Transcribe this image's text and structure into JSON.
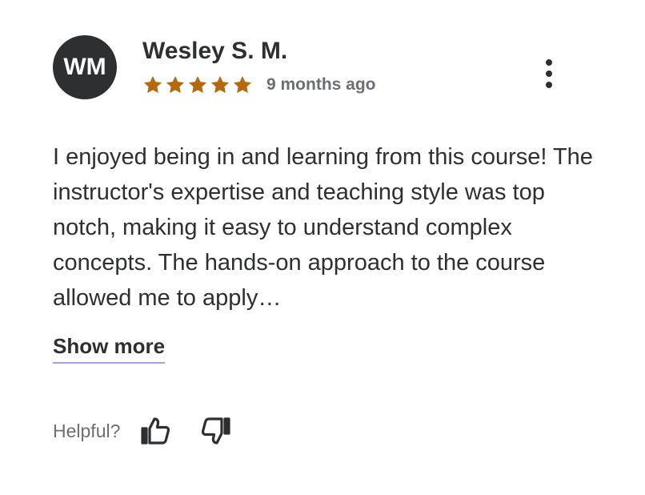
{
  "review": {
    "avatar_initials": "WM",
    "reviewer_name": "Wesley S. M.",
    "rating": 5,
    "max_rating": 5,
    "star_color": "#b4690e",
    "time_ago": "9 months ago",
    "text": "I enjoyed being in and learning from this course! The instructor's expertise and teaching style was top notch, making it easy to understand complex concepts. The hands-on approach to the course allowed me to apply…",
    "show_more_label": "Show more",
    "helpful_label": "Helpful?",
    "icons": {
      "more": "more-vertical-icon",
      "thumbs_up": "thumbs-up-icon",
      "thumbs_down": "thumbs-down-icon",
      "star": "star-icon"
    }
  }
}
